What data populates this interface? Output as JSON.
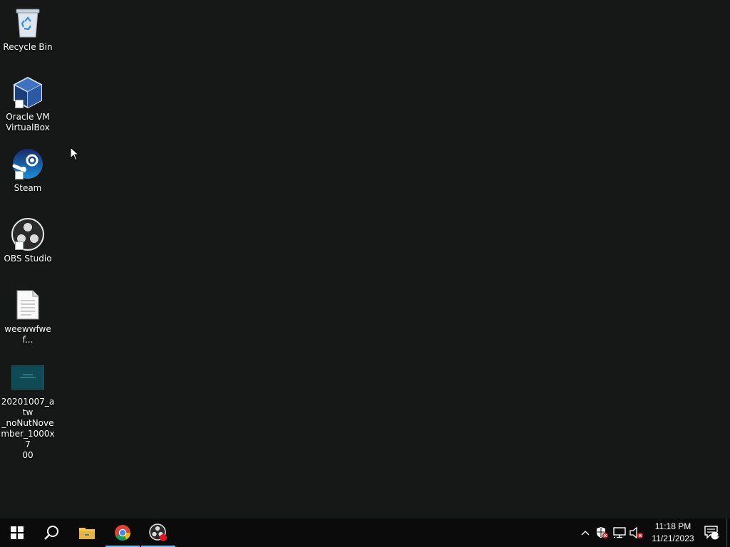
{
  "desktop": {
    "icons": [
      {
        "label": "Recycle Bin",
        "icon": "recycle-bin-icon",
        "shortcut": false
      },
      {
        "label": "Oracle VM\nVirtualBox",
        "icon": "virtualbox-icon",
        "shortcut": true
      },
      {
        "label": "Steam",
        "icon": "steam-icon",
        "shortcut": true
      },
      {
        "label": "OBS Studio",
        "icon": "obs-studio-icon",
        "shortcut": true
      },
      {
        "label": "weewwfwef...",
        "icon": "text-file-icon",
        "shortcut": false
      },
      {
        "label": "20201007_atw\n_noNutNove\nmber_1000x7\n00",
        "icon": "image-file-icon",
        "shortcut": false
      }
    ]
  },
  "taskbar": {
    "pinned": [
      {
        "name": "start",
        "icon": "windows-start-icon"
      },
      {
        "name": "search",
        "icon": "search-icon"
      },
      {
        "name": "file-explorer",
        "icon": "folder-icon"
      },
      {
        "name": "chrome",
        "icon": "chrome-icon",
        "active": true
      },
      {
        "name": "obs-studio",
        "icon": "obs-recording-icon",
        "active": true
      }
    ],
    "tray": {
      "time": "11:18 PM",
      "date": "11/21/2023",
      "notification_count": "1"
    }
  },
  "colors": {
    "desktop_bg": "#161717",
    "taskbar_bg": "#0b0b0b",
    "active_indicator": "#76b9ed",
    "recording_red": "#e81123"
  }
}
